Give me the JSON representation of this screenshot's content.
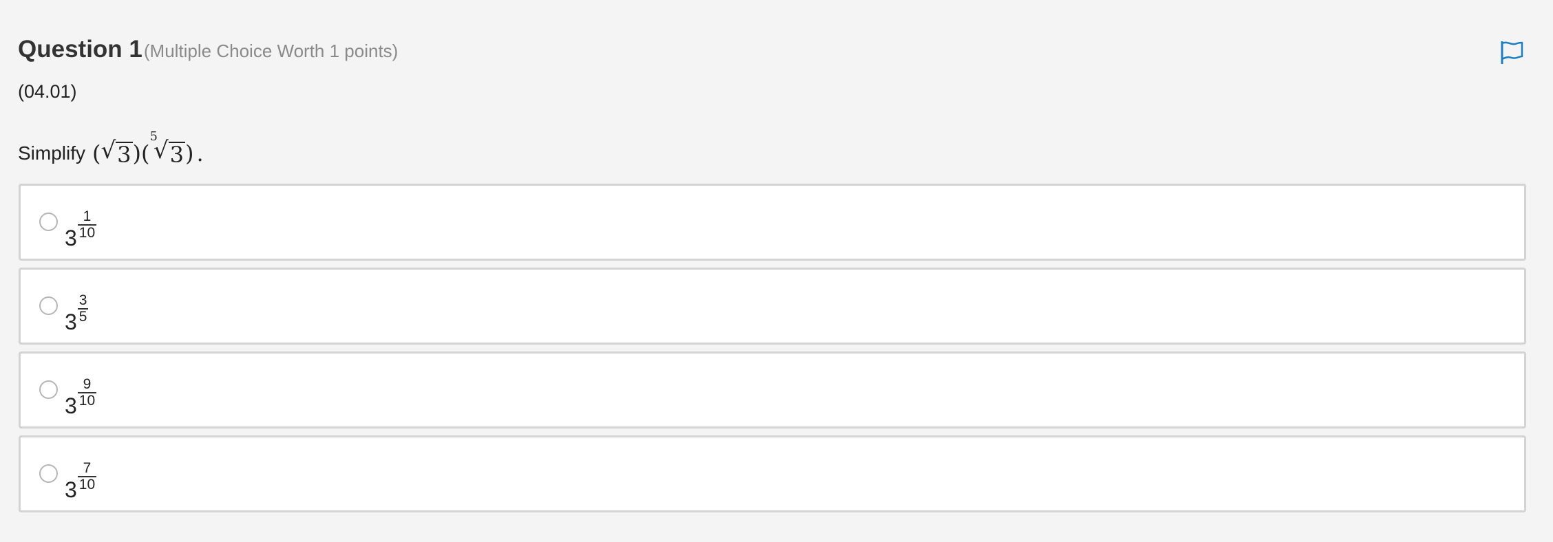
{
  "question": {
    "title": "Question 1",
    "meta": "(Multiple Choice Worth 1 points)",
    "code": "(04.01)",
    "prompt_text": "Simplify",
    "expression": {
      "open_paren_1": "(",
      "radical_symbol": "√",
      "radicand_1": "3",
      "close_paren_1": ")",
      "open_paren_2": "(",
      "root_index": "5",
      "radicand_2": "3",
      "close_paren_2": ")",
      "period": "."
    }
  },
  "flag": {
    "icon": "flag-icon",
    "color": "#1a7fc1"
  },
  "options": [
    {
      "base": "3",
      "numerator": "1",
      "denominator": "10"
    },
    {
      "base": "3",
      "numerator": "3",
      "denominator": "5"
    },
    {
      "base": "3",
      "numerator": "9",
      "denominator": "10"
    },
    {
      "base": "3",
      "numerator": "7",
      "denominator": "10"
    }
  ]
}
